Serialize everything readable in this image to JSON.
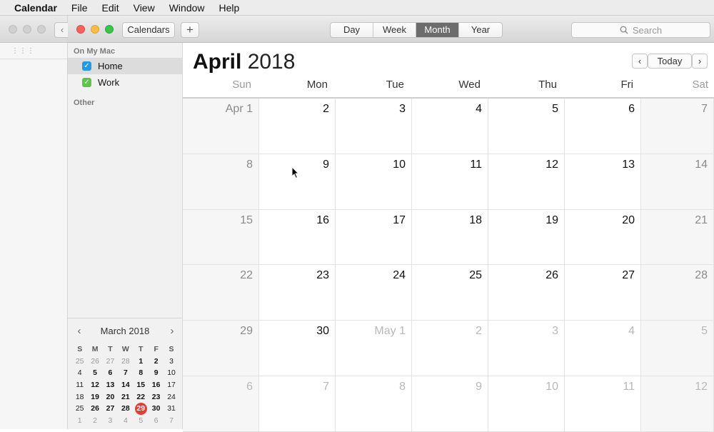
{
  "menubar": {
    "app": "Calendar",
    "items": [
      "File",
      "Edit",
      "View",
      "Window",
      "Help"
    ]
  },
  "toolbar": {
    "calendars_label": "Calendars",
    "add_label": "+",
    "views": [
      "Day",
      "Week",
      "Month",
      "Year"
    ],
    "active_view": "Month",
    "search_placeholder": "Search"
  },
  "sidebar": {
    "section_mac": "On My Mac",
    "calendars": [
      {
        "name": "Home",
        "color": "#1e9be6",
        "checked": true,
        "selected": true
      },
      {
        "name": "Work",
        "color": "#5dc546",
        "checked": true,
        "selected": false
      }
    ],
    "section_other": "Other"
  },
  "mini_calendar": {
    "title": "March 2018",
    "prev": "‹",
    "next": "›",
    "weekdays": [
      "S",
      "M",
      "T",
      "W",
      "T",
      "F",
      "S"
    ],
    "weeks": [
      [
        "25",
        "26",
        "27",
        "28",
        "1",
        "2",
        "3"
      ],
      [
        "4",
        "5",
        "6",
        "7",
        "8",
        "9",
        "10"
      ],
      [
        "11",
        "12",
        "13",
        "14",
        "15",
        "16",
        "17"
      ],
      [
        "18",
        "19",
        "20",
        "21",
        "22",
        "23",
        "24"
      ],
      [
        "25",
        "26",
        "27",
        "28",
        "29",
        "30",
        "31"
      ],
      [
        "1",
        "2",
        "3",
        "4",
        "5",
        "6",
        "7"
      ]
    ],
    "today": "29"
  },
  "main": {
    "month": "April",
    "year": "2018",
    "nav_prev": "‹",
    "today_label": "Today",
    "nav_next": "›",
    "weekdays": [
      "Sun",
      "Mon",
      "Tue",
      "Wed",
      "Thu",
      "Fri",
      "Sat"
    ],
    "weeks": [
      [
        "Apr 1",
        "2",
        "3",
        "4",
        "5",
        "6",
        "7"
      ],
      [
        "8",
        "9",
        "10",
        "11",
        "12",
        "13",
        "14"
      ],
      [
        "15",
        "16",
        "17",
        "18",
        "19",
        "20",
        "21"
      ],
      [
        "22",
        "23",
        "24",
        "25",
        "26",
        "27",
        "28"
      ],
      [
        "29",
        "30",
        "May 1",
        "2",
        "3",
        "4",
        "5"
      ],
      [
        "6",
        "7",
        "8",
        "9",
        "10",
        "11",
        "12"
      ]
    ]
  }
}
